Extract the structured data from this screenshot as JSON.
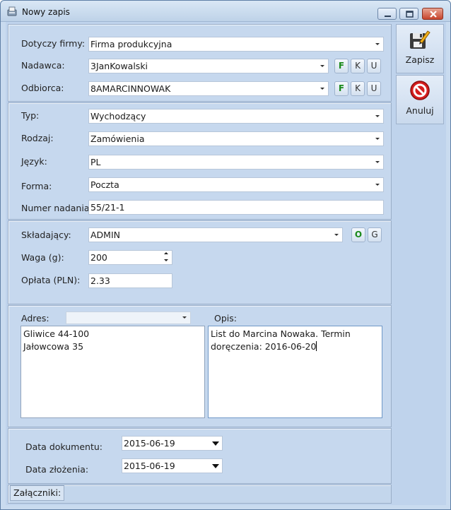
{
  "window": {
    "title": "Nowy zapis"
  },
  "toolbar": {
    "save_label": "Zapisz",
    "cancel_label": "Anuluj"
  },
  "section1": {
    "firma_label": "Dotyczy firmy:",
    "firma_value": "Firma produkcyjna",
    "nadawca_label": "Nadawca:",
    "nadawca_value": "3JanKowalski",
    "odbiorca_label": "Odbiorca:",
    "odbiorca_value": "8AMARCINNOWAK",
    "btn_f": "F",
    "btn_k": "K",
    "btn_u": "U"
  },
  "section2": {
    "typ_label": "Typ:",
    "typ_value": "Wychodzący",
    "rodzaj_label": "Rodzaj:",
    "rodzaj_value": "Zamówienia",
    "jezyk_label": "Język:",
    "jezyk_value": "PL",
    "forma_label": "Forma:",
    "forma_value": "Poczta",
    "numer_label": "Numer nadania:",
    "numer_value": "55/21-1"
  },
  "section3": {
    "skladajacy_label": "Składający:",
    "skladajacy_value": "ADMIN",
    "btn_o": "O",
    "btn_g": "G",
    "waga_label": "Waga (g):",
    "waga_value": "200",
    "oplata_label": "Opłata (PLN):",
    "oplata_value": "2.33"
  },
  "section4": {
    "adres_label": "Adres:",
    "adres_select_value": "",
    "adres_lines": [
      "Gliwice 44-100",
      "Jałowcowa 35"
    ],
    "opis_label": "Opis:",
    "opis_lines": [
      "List do Marcina Nowaka. Termin",
      "doręczenia: 2016-06-20"
    ]
  },
  "section5": {
    "data_dok_label": "Data dokumentu:",
    "data_dok_value": "2015-06-19",
    "data_zl_label": "Data złożenia:",
    "data_zl_value": "2015-06-19"
  },
  "attachments": {
    "tab_label": "Załączniki:"
  }
}
